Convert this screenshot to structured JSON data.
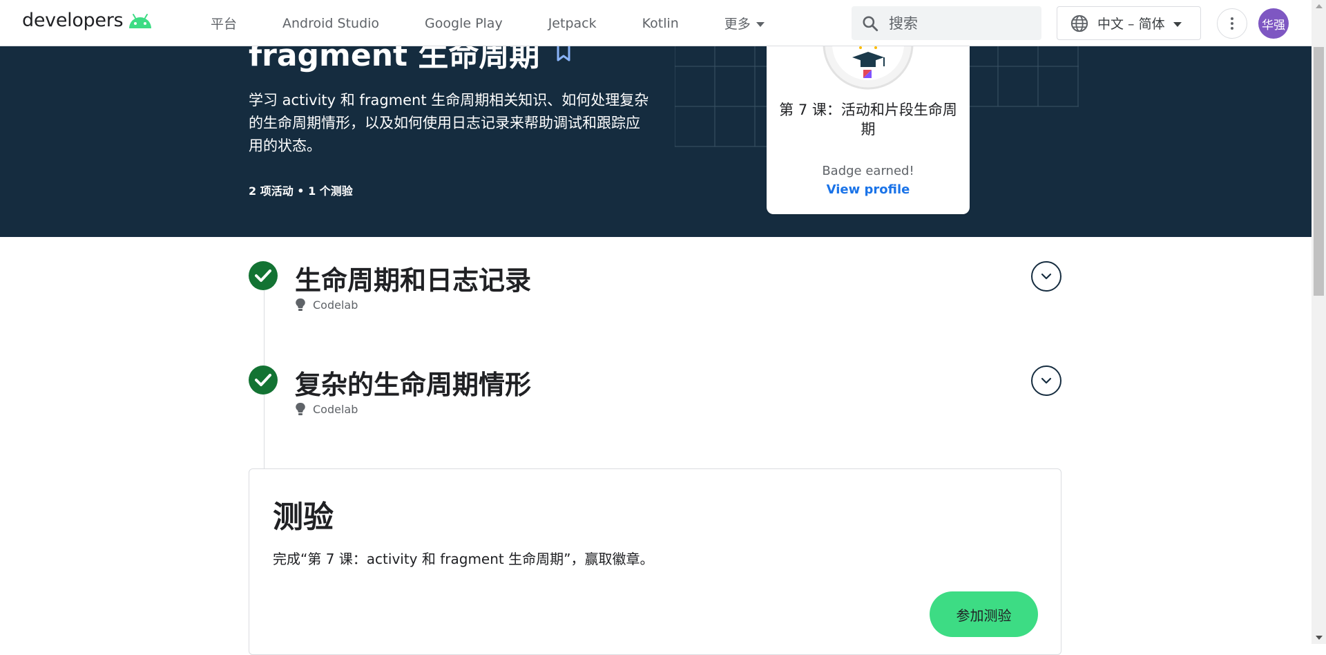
{
  "header": {
    "logo_text": "developers",
    "nav": [
      "平台",
      "Android Studio",
      "Google Play",
      "Jetpack",
      "Kotlin"
    ],
    "more_label": "更多",
    "search_placeholder": "搜索",
    "language": "中文 – 简体",
    "avatar_text": "华强"
  },
  "hero": {
    "title": "fragment 生命周期",
    "description": "学习 activity 和 fragment 生命周期相关知识、如何处理复杂的生命周期情形，以及如何使用日志记录来帮助调试和跟踪应用的状态。",
    "meta": "2 项活动 • 1 个测验"
  },
  "badge": {
    "title": "第 7 课：活动和片段生命周期",
    "status": "Badge earned!",
    "link": "View profile"
  },
  "activities": [
    {
      "title": "生命周期和日志记录",
      "type": "Codelab"
    },
    {
      "title": "复杂的生命周期情形",
      "type": "Codelab"
    }
  ],
  "quiz": {
    "title": "测验",
    "description": "完成“第 7 课：activity 和 fragment 生命周期”，赢取徽章。",
    "button": "参加测验"
  },
  "colors": {
    "hero_bg": "#152c3f",
    "check_green": "#137333",
    "quiz_button": "#3ddc84",
    "link_blue": "#1a73e8"
  }
}
